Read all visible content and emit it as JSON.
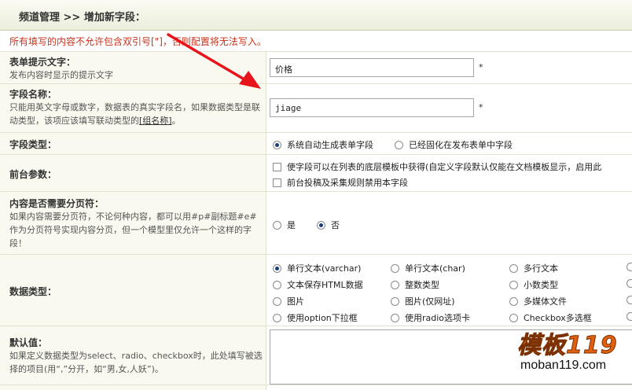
{
  "breadcrumb": "频道管理 >> 增加新字段：",
  "notice": "所有填写的内容不允许包含双引号[\"]，否则配置将无法写入。",
  "fields": {
    "tip": {
      "label": "表单提示文字：",
      "desc": "发布内容时显示的提示文字",
      "value": "价格",
      "required": "*"
    },
    "name": {
      "label": "字段名称：",
      "desc_pre": "只能用英文字母或数字，数据表的真实字段名，如果数据类型是联动类型，该项应该填写联动类型的",
      "desc_link": "[组名称]",
      "desc_post": "。",
      "value": "jiage",
      "required": "*"
    },
    "field_type": {
      "label": "字段类型：",
      "options": [
        "系统自动生成表单字段",
        "已经固化在发布表单中字段"
      ],
      "selected": 0
    },
    "frontend": {
      "label": "前台参数：",
      "checkboxes": [
        "使字段可以在列表的底层模板中获得(自定义字段默认仅能在文档模板显示，启用此",
        "前台投稿及采集规则禁用本字段"
      ]
    },
    "paging": {
      "label": "内容是否需要分页符：",
      "desc": "如果内容需要分页符，不论何种内容，都可以用#p#副标题#e#作为分页符号实现内容分页，但一个模型里仅允许一个这样的字段！",
      "options": [
        "是",
        "否"
      ],
      "selected": 1
    },
    "data_type": {
      "label": "数据类型：",
      "options": [
        "单行文本(varchar)",
        "单行文本(char)",
        "多行文本",
        "文本保存HTML数据",
        "整数类型",
        "小数类型",
        "图片",
        "图片(仅网址)",
        "多媒体文件",
        "使用option下拉框",
        "使用radio选项卡",
        "Checkbox多选框"
      ],
      "selected": 0
    },
    "default": {
      "label": "默认值：",
      "desc": "如果定义数据类型为select、radio、checkbox时，此处填写被选择的项目(用“,”分开，如“男,女,人妖”)。"
    }
  },
  "watermark": {
    "cn": "模板119",
    "en": "moban119.com"
  },
  "colors": {
    "notice": "#c8321d",
    "arrow": "#e8141b",
    "header_bg": "#eceedd"
  }
}
